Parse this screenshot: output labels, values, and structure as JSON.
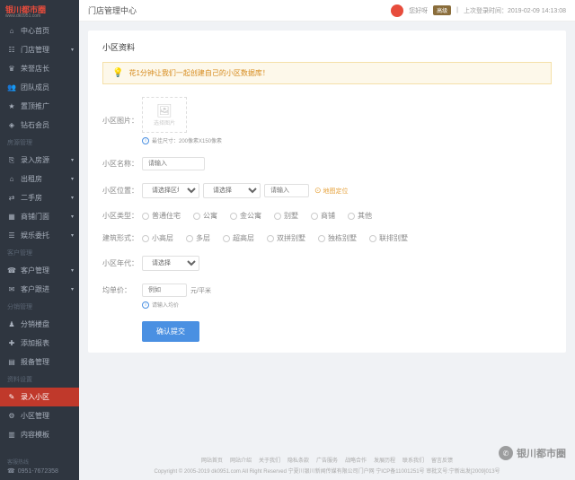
{
  "logo": {
    "main": "银川都市圈",
    "sub": "www.dk0951.com"
  },
  "header": {
    "title": "门店管理中心",
    "greet": "您好呀",
    "badge": "高级",
    "status": "上次登录时间：2019-02-09 14:13:08"
  },
  "sidebar": {
    "items": [
      {
        "icon": "⌂",
        "label": "中心首页"
      },
      {
        "icon": "☷",
        "label": "门店管理",
        "arr": "▾"
      },
      {
        "icon": "♛",
        "label": "荣誉店长"
      },
      {
        "icon": "👥",
        "label": "团队成员"
      },
      {
        "icon": "★",
        "label": "置顶推广"
      },
      {
        "icon": "◈",
        "label": "钻石会员"
      }
    ],
    "g1h": "房源管理",
    "g1": [
      {
        "icon": "⎘",
        "label": "录入房源",
        "arr": "▾"
      },
      {
        "icon": "⌂",
        "label": "出租房",
        "arr": "▾"
      },
      {
        "icon": "⇄",
        "label": "二手房",
        "arr": "▾"
      },
      {
        "icon": "▦",
        "label": "商铺门面",
        "arr": "▾"
      },
      {
        "icon": "☰",
        "label": "娱乐委托",
        "arr": "▾"
      }
    ],
    "g2h": "客户管理",
    "g2": [
      {
        "icon": "☎",
        "label": "客户管理",
        "arr": "▾"
      },
      {
        "icon": "✉",
        "label": "客户跟进",
        "arr": "▾"
      }
    ],
    "g3h": "分销管理",
    "g3": [
      {
        "icon": "♟",
        "label": "分销楼盘"
      },
      {
        "icon": "✚",
        "label": "添加报表"
      },
      {
        "icon": "▤",
        "label": "报备管理"
      }
    ],
    "g4h": "资料设置",
    "g4": [
      {
        "icon": "✎",
        "label": "录入小区"
      },
      {
        "icon": "⚙",
        "label": "小区管理"
      },
      {
        "icon": "▥",
        "label": "内容模板"
      }
    ],
    "contact_h": "客服热线",
    "contact": "0951-7672358"
  },
  "panel": {
    "title": "小区资料",
    "tip": "花1分钟让我们一起创建自己的小区数据库！",
    "f_pic": "小区图片：",
    "upload": "选择图片",
    "pic_hint": "最佳尺寸：200像素X150像素",
    "f_name": "小区名称：",
    "name_ph": "请输入",
    "f_loc": "小区位置：",
    "sel1": "请选择区域",
    "sel2": "请选择",
    "loc_ph": "请输入",
    "loc_btn": "地图定位",
    "f_type": "小区类型：",
    "types": [
      "普通住宅",
      "公寓",
      "金公寓",
      "别墅",
      "商铺",
      "其他"
    ],
    "f_build": "建筑形式：",
    "builds": [
      "小高层",
      "多层",
      "超高层",
      "双拼别墅",
      "独栋别墅",
      "联排别墅"
    ],
    "f_year": "小区年代：",
    "year_ph": "请选择",
    "f_price": "均单价：",
    "price_ph": "例如",
    "price_unit": "元/平米",
    "price_hint": "请输入均价",
    "submit": "确认提交"
  },
  "footer": {
    "links": [
      "网站首页",
      "网站介绍",
      "关于我们",
      "隐私条款",
      "广告服务",
      "战略合作",
      "发展历程",
      "联系我们",
      "留言反馈"
    ],
    "copy": "Copyright © 2005-2019 dk0951.com All Right Reserved 宁夏川银川新闻传媒有限公司门户网  宁ICP备11001251号  审批文号:宁新出发[2009]013号"
  },
  "wm": "银川都市圈"
}
